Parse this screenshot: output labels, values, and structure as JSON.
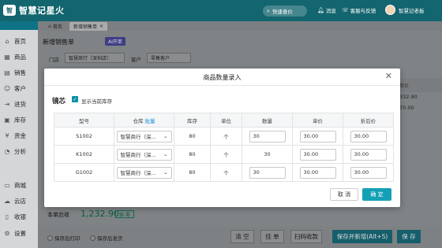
{
  "app": {
    "name": "智慧记星火",
    "logo_mark": "智"
  },
  "topbar": {
    "search_label": "快速查价",
    "messages_label": "消息",
    "feedback_label": "客服与反馈",
    "user_name": "智慧记老板"
  },
  "sidebar": {
    "items": [
      {
        "icon": "⌂",
        "label": "首页"
      },
      {
        "icon": "▦",
        "label": "商品"
      },
      {
        "icon": "▤",
        "label": "销售"
      },
      {
        "icon": "☺",
        "label": "客户"
      },
      {
        "icon": "⇥",
        "label": "进货"
      },
      {
        "icon": "▣",
        "label": "库存"
      },
      {
        "icon": "¥",
        "label": "资金"
      },
      {
        "icon": "◔",
        "label": "分析"
      },
      {
        "icon": "▭",
        "label": "商城"
      },
      {
        "icon": "☁",
        "label": "云店"
      },
      {
        "icon": "▯",
        "label": "收银"
      },
      {
        "icon": "⚙",
        "label": "设置"
      }
    ]
  },
  "tabs": {
    "home": "首页",
    "active": "新增销售单"
  },
  "page": {
    "title": "新增销售单",
    "ai_badge": "AI开单",
    "store_label": "门店",
    "store_value": "智慧商行（深圳店）",
    "customer_label": "客户",
    "customer_value": "零售客户",
    "bg_col_price": "单价",
    "bg_price_1": "332.90",
    "bg_price_2": "70.00",
    "total_label": "本单应收",
    "total_value": "1,232.90",
    "total_badge": "抹 零"
  },
  "footer": {
    "opt_print": "保存后打印",
    "opt_ship": "保存后发货",
    "clear": "清 空",
    "hang": "挂 单",
    "scan": "扫码收款",
    "save_new": "保存并新增(Alt+S)",
    "save": "保 存"
  },
  "modal": {
    "title": "商品数量录入",
    "product_name": "镜芯",
    "show_stock_label": "显示当前库存",
    "columns": {
      "model": "型号",
      "warehouse": "仓库",
      "batch": "批量",
      "stock": "库存",
      "unit": "单位",
      "qty": "数量",
      "price": "单价",
      "discount_price": "折后价"
    },
    "rows": [
      {
        "model": "S1002",
        "warehouse": "智慧商行（深...",
        "stock": "80",
        "unit": "个",
        "qty": "30",
        "qty_input": true,
        "price": "30.00",
        "discount_price": "30.00"
      },
      {
        "model": "K1002",
        "warehouse": "智慧商行（深...",
        "stock": "80",
        "unit": "个",
        "qty": "30",
        "qty_input": false,
        "price": "30.00",
        "discount_price": "30.00"
      },
      {
        "model": "G1002",
        "warehouse": "智慧商行（深...",
        "stock": "80",
        "unit": "个",
        "qty": "30",
        "qty_input": true,
        "price": "30.00",
        "discount_price": "30.00"
      }
    ],
    "cancel": "取 消",
    "ok": "确 定"
  },
  "colors": {
    "brand": "#13656f",
    "accent": "#14a0b6",
    "link": "#1b8fd6"
  }
}
